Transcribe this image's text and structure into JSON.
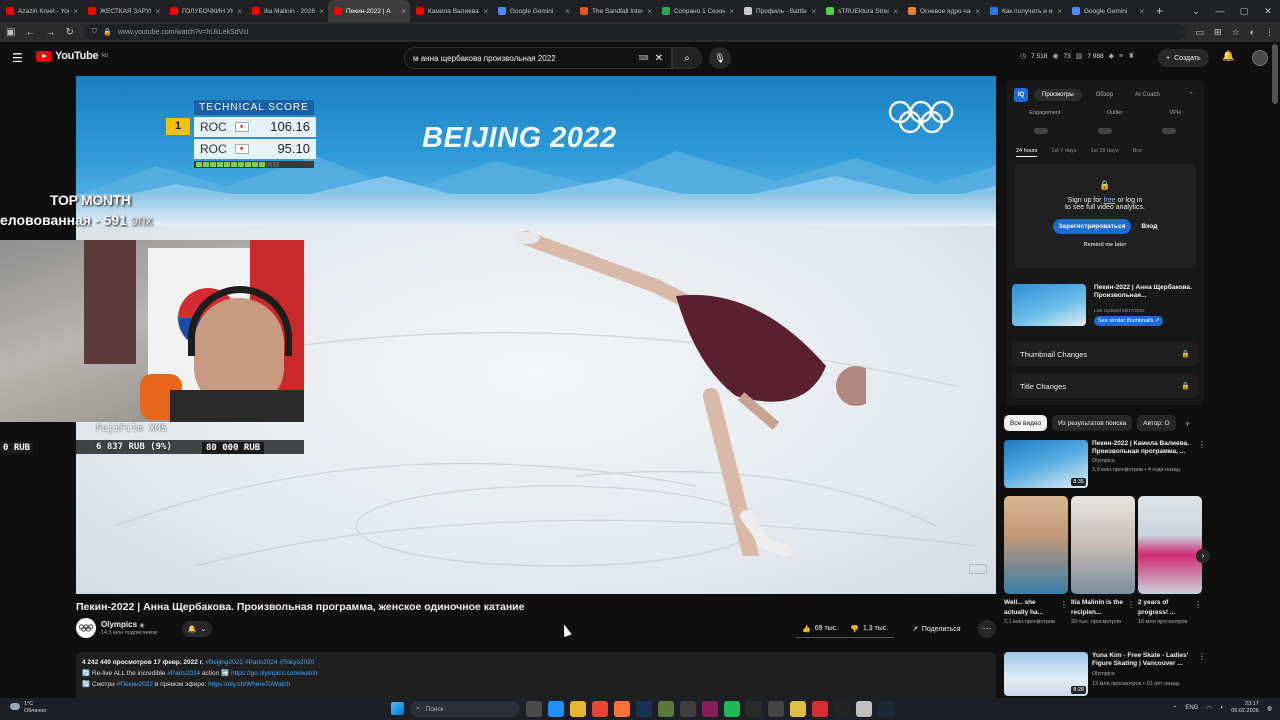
{
  "browser": {
    "tabs": [
      {
        "title": "Azazin Kreet - YouT",
        "color": "#ff0000",
        "active": false
      },
      {
        "title": "ЖЕСТКАЯ ЗАРУБА",
        "color": "#ff0000",
        "active": false
      },
      {
        "title": "ГОЛУБОЧКИН УНІ",
        "color": "#ff0000",
        "active": false
      },
      {
        "title": "Ilia Malinin - 2026 (",
        "color": "#ff0000",
        "active": false
      },
      {
        "title": "Пекин-2022 | А",
        "color": "#ff0000",
        "active": true
      },
      {
        "title": "Камила Валиева. К",
        "color": "#ff0000",
        "active": false
      },
      {
        "title": "Google Gemini",
        "color": "#4f8bf5",
        "active": false
      },
      {
        "title": "The Sandfall Intera",
        "color": "#e25533",
        "active": false
      },
      {
        "title": "Сопрано 1 Сезон (",
        "color": "#2aa84a",
        "active": false
      },
      {
        "title": "Профиль - Battles",
        "color": "#c8c8c8",
        "active": false
      },
      {
        "title": "sTRUEktura Stream",
        "color": "#53d147",
        "active": false
      },
      {
        "title": "Огневое ядро час",
        "color": "#e2862c",
        "active": false
      },
      {
        "title": "Как получить и ис",
        "color": "#2a7be4",
        "active": false
      },
      {
        "title": "Google Gemini",
        "color": "#4f8bf5",
        "active": false
      }
    ],
    "new_tab": "+",
    "close_glyph": "×",
    "url": "www.youtube.com/watch?v=hUkLekSdVcI"
  },
  "youtube": {
    "logo_text": "YouTube",
    "region": "RU",
    "search_value": "м анна щербакова произвольная 2022",
    "stats": {
      "a": "7 518",
      "b": "73",
      "c": "7 988"
    },
    "create_label": "Создать"
  },
  "player": {
    "banner_text": "BEIJING 2022",
    "score_header": "TECHNICAL SCORE",
    "scores": [
      {
        "rank": "1",
        "country": "ROC",
        "score": "106.16"
      },
      {
        "rank": "",
        "country": "ROC",
        "score": "95.10"
      }
    ],
    "top_month": "TOP MONTH",
    "overlay_line": "еловованная - 591",
    "overlay_line_suffix": "эпх",
    "cam_caption": "FujiFilm XM5",
    "rub_left": "0 RUB",
    "rub_mid": "6 837 RUB (9%)",
    "rub_right": "80 000 RUB"
  },
  "video": {
    "title": "Пекин-2022 | Анна Щербакова. Произвольная программа, женское одиночное катание",
    "channel": "Olympics",
    "subscribers": "14,5 млн подписчиков",
    "likes": "69 тыс.",
    "dislikes": "1,3 тыс.",
    "share": "Поделиться",
    "more": "···",
    "description": {
      "views_date": "4 242 449 просмотров  17 февр. 2022 г.",
      "tags": "#Beijing2022 #Paris2024 #Tokyo2020",
      "line2_prefix": "🔄 Re-live ALL the incredible",
      "line2_tag": "#Paris2024",
      "line2_mid": "action ➡️",
      "line2_link": "https://go.olympics.com/watch",
      "line3_prefix": "🔄 Смотри",
      "line3_tag": "#Пекин2022",
      "line3_mid": "в прямом эфире:",
      "line3_link": "https://oly.ch/WhereToWatch"
    }
  },
  "sidebar": {
    "vidiq": {
      "logo": "IQ",
      "tabs": [
        "Просмотры",
        "Обзор",
        "AI Coach"
      ],
      "metrics": [
        "Engagement",
        "Outlier",
        "VPH"
      ],
      "periods": [
        "24 hours",
        "1st 7 days",
        "1st 28 days",
        "Все"
      ],
      "lock_line1_a": "Sign up for",
      "lock_line1_free": "free",
      "lock_line1_b": "or log in",
      "lock_line2": "to see full video analytics.",
      "register": "Зарегистрироваться",
      "login": "Вход",
      "remind": "Remind me later",
      "card_title": "Пекин-2022 | Анна Щербакова. Произвольная...",
      "card_updated": "Last Updated 02/17/2022",
      "card_similar": "See similar thumbnails ↗",
      "rows": [
        "Thumbnail Changes",
        "Title Changes"
      ]
    },
    "chips": [
      "Все видео",
      "Из результатов поиска",
      "Автор: O"
    ],
    "rec1": {
      "title": "Пекин-2022 | Камила Валиева. Произвольная программа, ...",
      "channel": "Olympics",
      "meta": "3,9 млн просмотров • 4 года назад",
      "duration": "8:35"
    },
    "shorts": [
      {
        "title": "Well... she actually ha...",
        "views": "2,1 млн просмотров"
      },
      {
        "title": "Ilia Malinin is the recipien...",
        "views": "20 тыс. просмотров"
      },
      {
        "title": "2 years of progress! ...",
        "views": "16 млн просмотров"
      }
    ],
    "rec2": {
      "title": "Yuna Kim - Free Skate - Ladies' Figure Skating | Vancouver ...",
      "channel": "Olympics",
      "meta": "13 млн просмотров • 10 лет назад",
      "duration": "8:28"
    }
  },
  "taskbar": {
    "weather_temp": "1°C",
    "weather_desc": "Облачно",
    "search": "Поиск",
    "lang": "ENG",
    "time": "23:17",
    "date": "05.02.2026"
  }
}
